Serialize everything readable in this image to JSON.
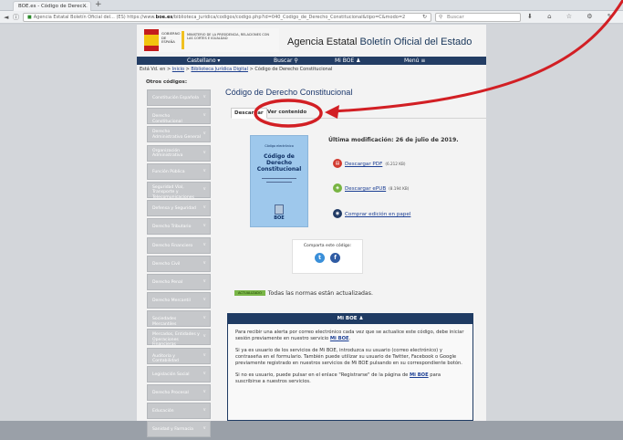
{
  "browser": {
    "tab_title": "BOE.es - Código de Derec...",
    "tab_close": "×",
    "new_tab": "+",
    "back": "◄",
    "info": "ⓘ",
    "url_prefix": "Agencia Estatal Boletín Oficial del... (ES)  https://www.",
    "url_domain": "boe.es",
    "url_rest": "/biblioteca_juridica/codigos/codigo.php?id=040_Codigo_de_Derecho_Constitucional&tipo=C&modo=2",
    "reload": "↻",
    "search_placeholder": "Buscar",
    "search_icon": "⚲",
    "toolbar_icons": "⬇ ⌂ ☆ ⚙ ✎ ≡"
  },
  "header": {
    "gob_line": "GOBIERNO DE ESPAÑA",
    "ministry": "MINISTERIO DE LA PRESIDENCIA, RELACIONES CON LAS CORTES E IGUALDAD",
    "agency_prefix": "Agencia Estatal ",
    "agency_name": "Boletín Oficial del Estado"
  },
  "menu": {
    "language": "Castellano ▾",
    "search": "Buscar ⚲",
    "myboe": "Mi BOE ♟",
    "menu": "Menú ≡"
  },
  "breadcrumb": {
    "prefix": "Está Vd. en",
    "home": "Inicio",
    "sep1": ">",
    "library": "Biblioteca Jurídica Digital",
    "sep2": ">",
    "current": "Código de Derecho Constitucional"
  },
  "sidebar": {
    "title": "Otros códigos:",
    "chevron": "∨",
    "items": [
      "Constitución Española",
      "Derecho Constitucional",
      "Derecho Administrativo General",
      "Organización Administrativa",
      "Función Pública",
      "Seguridad Vial, Transporte y Telecomunicaciones",
      "Defensa y Seguridad",
      "Derecho Tributario",
      "Derecho Financiero",
      "Derecho Civil",
      "Derecho Penal",
      "Derecho Mercantil",
      "Sociedades Mercantiles",
      "Mercados, Entidades y Operaciones Financieras",
      "Auditoría y Contabilidad",
      "Legislación Social",
      "Derecho Procesal",
      "Educación",
      "Sanidad y Farmacia"
    ]
  },
  "main": {
    "title": "Código de Derecho Constitucional",
    "tab_download": "Descargar",
    "tab_view": "Ver contenido",
    "cover": {
      "edition": "Código electrónico",
      "title": "Código de Derecho Constitucional",
      "boe": "BOE"
    },
    "last_mod_label": "Última modificación:",
    "last_mod_date": "26 de julio de 2019.",
    "pdf_label": "Descargar PDF",
    "pdf_size": "(6.212 KB)",
    "epub_label": "Descargar ePUB",
    "epub_size": "(8.194 KB)",
    "paper_label": "Comprar edición en papel",
    "icon_pdf": "▤",
    "icon_epub": "◈",
    "icon_paper": "◉",
    "share_label": "Comparta este código:",
    "share_twitter": "t",
    "share_facebook": "f",
    "status_badge": "ACTUALIZADO",
    "status_text": "Todas las normas están actualizadas."
  },
  "myboe": {
    "title": "Mi BOE ♟",
    "p1a": "Para recibir una alerta por correo electrónico cada vez que se actualice este código, debe iniciar sesión previamente en nuestro servicio ",
    "p1link": "Mi BOE",
    "p1b": ".",
    "p2": "Si ya es usuario de los servicios de Mi BOE, introduzca su usuario (correo electrónico) y contraseña en el formulario. También puede utilizar su usuario de Twitter, Facebook o Google previamente registrado en nuestros servicios de Mi BOE pulsando en su correspondiente botón.",
    "p3a": "Si no es usuario, puede pulsar en el enlace \"Registrarse\" de la página de ",
    "p3link": "Mi BOE",
    "p3b": " para suscribirse a nuestros servicios."
  },
  "annotation": {
    "color": "#d21f24"
  }
}
